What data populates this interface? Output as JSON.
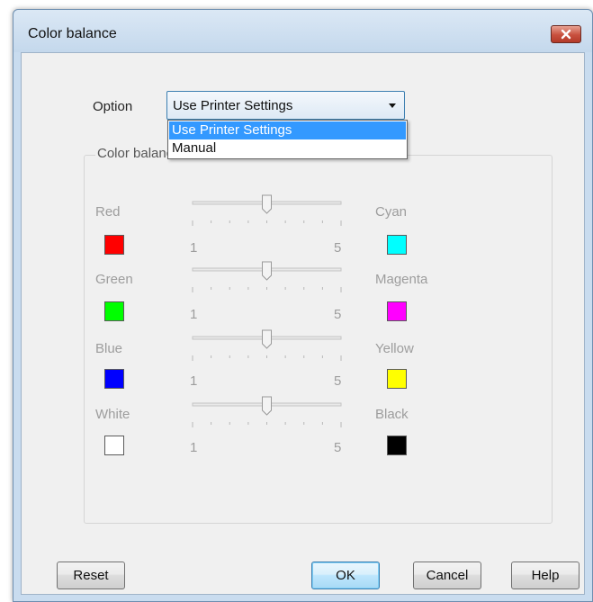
{
  "window": {
    "title": "Color balance"
  },
  "option": {
    "label": "Option",
    "selected": "Use Printer Settings",
    "dropdown_items": [
      "Use Printer Settings",
      "Manual"
    ]
  },
  "group": {
    "title": "Color balance"
  },
  "rows": [
    {
      "left_label": "Red",
      "left_color": "#ff0000",
      "right_label": "Cyan",
      "right_color": "#00ffff",
      "min": "1",
      "max": "5",
      "value": 3
    },
    {
      "left_label": "Green",
      "left_color": "#00ff00",
      "right_label": "Magenta",
      "right_color": "#ff00ff",
      "min": "1",
      "max": "5",
      "value": 3
    },
    {
      "left_label": "Blue",
      "left_color": "#0000ff",
      "right_label": "Yellow",
      "right_color": "#ffff00",
      "min": "1",
      "max": "5",
      "value": 3
    },
    {
      "left_label": "White",
      "left_color": "#ffffff",
      "right_label": "Black",
      "right_color": "#000000",
      "min": "1",
      "max": "5",
      "value": 3
    }
  ],
  "buttons": {
    "reset": "Reset",
    "ok": "OK",
    "cancel": "Cancel",
    "help": "Help"
  }
}
